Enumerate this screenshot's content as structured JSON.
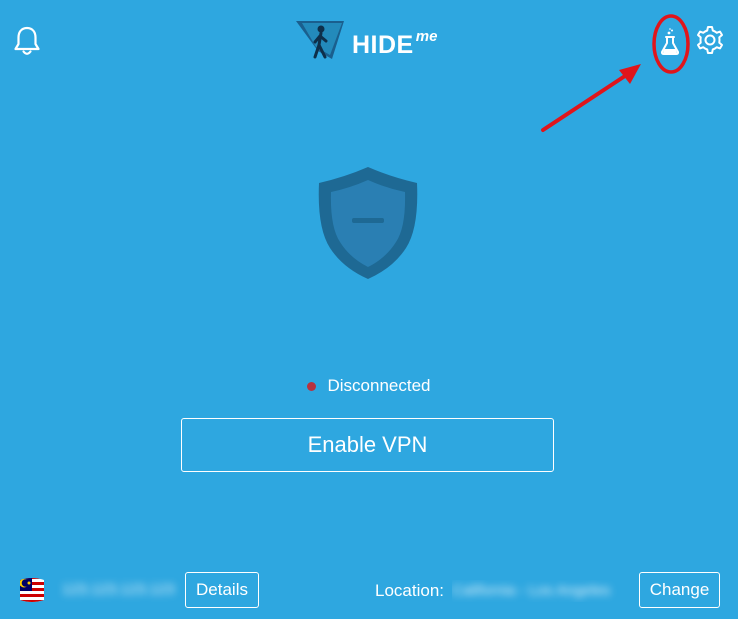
{
  "header": {
    "logo_main": "HIDE",
    "logo_suffix": "me"
  },
  "main": {
    "status_text": "Disconnected",
    "enable_button": "Enable VPN"
  },
  "footer": {
    "ip_text": "123.123.123.123",
    "details_button": "Details",
    "location_label": "Location:",
    "location_value": "California - Los Angeles",
    "change_button": "Change"
  },
  "icons": {
    "notifications": "bell-icon",
    "labs": "flask-icon",
    "settings": "gear-icon",
    "shield": "shield-icon",
    "flag": "malaysia-flag-icon"
  },
  "colors": {
    "background": "#2ea7e0",
    "shield": "#1e6994",
    "status_dot": "#b8323f",
    "annotation": "#e0151b"
  }
}
